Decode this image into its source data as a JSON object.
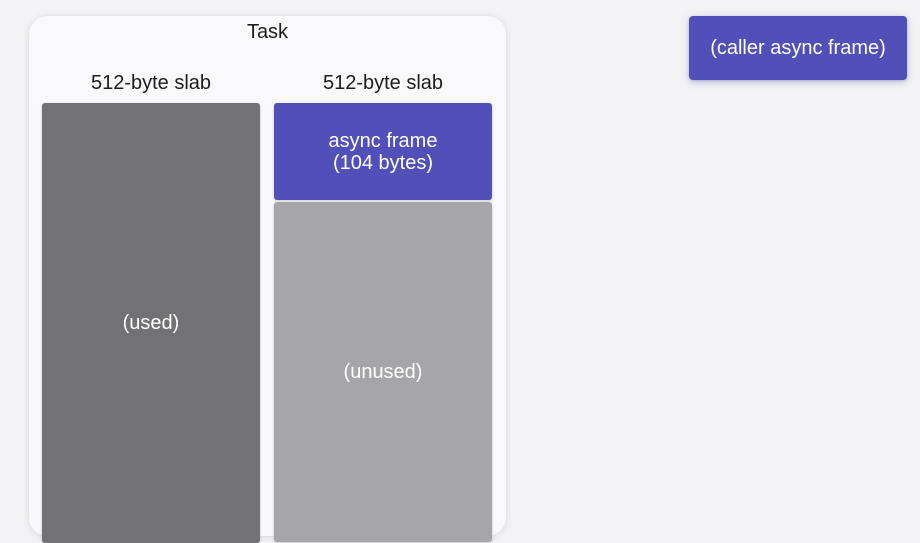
{
  "task": {
    "title": "Task",
    "slabs": [
      {
        "label": "512-byte slab",
        "used_label": "(used)"
      },
      {
        "label": "512-byte slab",
        "frame_line1": "async frame",
        "frame_line2": "(104 bytes)",
        "unused_label": "(unused)"
      }
    ]
  },
  "caller": {
    "label": "(caller async frame)"
  },
  "colors": {
    "frame": "#5150b8",
    "used": "#727274",
    "unused": "#a6a6a8",
    "background": "#f3f3f6"
  }
}
